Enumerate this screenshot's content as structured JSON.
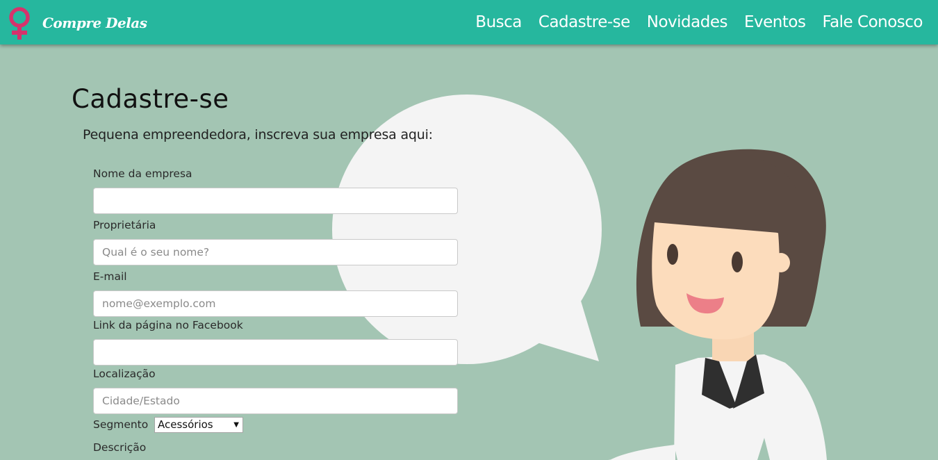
{
  "navbar": {
    "brand_name": "Compre Delas",
    "links": [
      "Busca",
      "Cadastre-se",
      "Novidades",
      "Eventos",
      "Fale Conosco"
    ]
  },
  "page": {
    "title": "Cadastre-se",
    "subtitle": "Pequena empreendedora, inscreva sua empresa aqui:"
  },
  "form": {
    "company_name": {
      "label": "Nome da empresa",
      "value": "",
      "placeholder": ""
    },
    "owner": {
      "label": "Proprietária",
      "value": "",
      "placeholder": "Qual é o seu nome?"
    },
    "email": {
      "label": "E-mail",
      "value": "",
      "placeholder": "nome@exemplo.com"
    },
    "facebook": {
      "label": "Link da página no Facebook",
      "value": "",
      "placeholder": ""
    },
    "location": {
      "label": "Localização",
      "value": "",
      "placeholder": "Cidade/Estado"
    },
    "segment": {
      "label": "Segmento",
      "selected": "Acessórios"
    },
    "description": {
      "label": "Descrição"
    }
  },
  "colors": {
    "navbar": "#26b79e",
    "background": "#a3c5b3",
    "brand_icon": "#d6336c"
  },
  "icons": {
    "brand": "female-symbol-icon",
    "select_arrow": "caret-down-icon"
  }
}
